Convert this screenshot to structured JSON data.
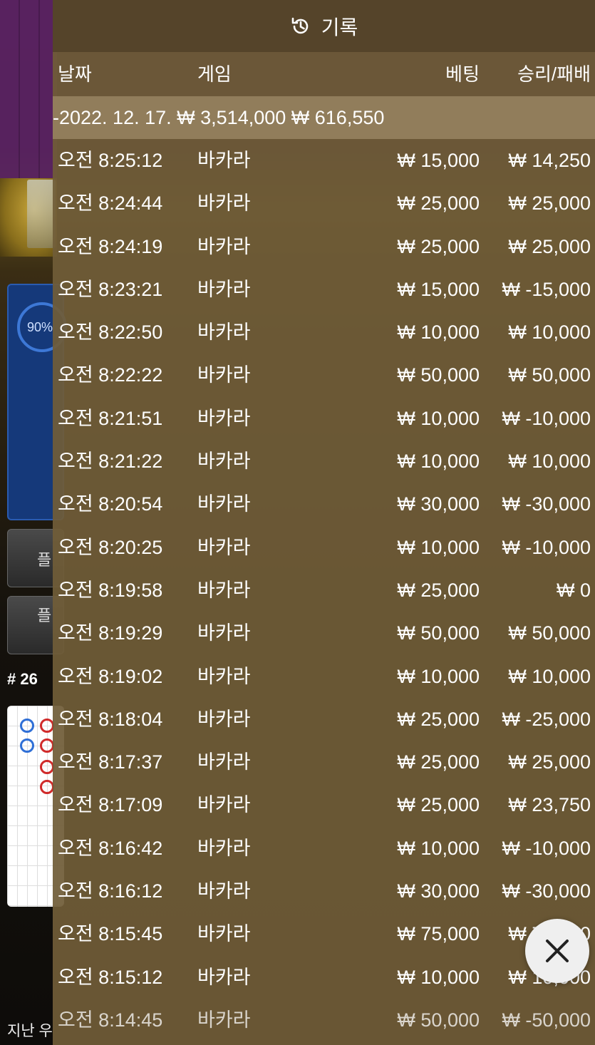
{
  "header": {
    "title": "기록",
    "icon": "history-icon"
  },
  "columns": {
    "date": "날짜",
    "game": "게임",
    "bet": "베팅",
    "result": "승리/패배"
  },
  "date_group": {
    "date": "-2022. 12. 17.",
    "bet_total": "₩ 3,514,000",
    "result_total": "₩ 616,550"
  },
  "rows": [
    {
      "time": "오전 8:25:12",
      "game": "바카라",
      "bet": "₩ 15,000",
      "result": "₩ 14,250"
    },
    {
      "time": "오전 8:24:44",
      "game": "바카라",
      "bet": "₩ 25,000",
      "result": "₩ 25,000"
    },
    {
      "time": "오전 8:24:19",
      "game": "바카라",
      "bet": "₩ 25,000",
      "result": "₩ 25,000"
    },
    {
      "time": "오전 8:23:21",
      "game": "바카라",
      "bet": "₩ 15,000",
      "result": "₩ -15,000"
    },
    {
      "time": "오전 8:22:50",
      "game": "바카라",
      "bet": "₩ 10,000",
      "result": "₩ 10,000"
    },
    {
      "time": "오전 8:22:22",
      "game": "바카라",
      "bet": "₩ 50,000",
      "result": "₩ 50,000"
    },
    {
      "time": "오전 8:21:51",
      "game": "바카라",
      "bet": "₩ 10,000",
      "result": "₩ -10,000"
    },
    {
      "time": "오전 8:21:22",
      "game": "바카라",
      "bet": "₩ 10,000",
      "result": "₩ 10,000"
    },
    {
      "time": "오전 8:20:54",
      "game": "바카라",
      "bet": "₩ 30,000",
      "result": "₩ -30,000"
    },
    {
      "time": "오전 8:20:25",
      "game": "바카라",
      "bet": "₩ 10,000",
      "result": "₩ -10,000"
    },
    {
      "time": "오전 8:19:58",
      "game": "바카라",
      "bet": "₩ 25,000",
      "result": "₩ 0"
    },
    {
      "time": "오전 8:19:29",
      "game": "바카라",
      "bet": "₩ 50,000",
      "result": "₩ 50,000"
    },
    {
      "time": "오전 8:19:02",
      "game": "바카라",
      "bet": "₩ 10,000",
      "result": "₩ 10,000"
    },
    {
      "time": "오전 8:18:04",
      "game": "바카라",
      "bet": "₩ 25,000",
      "result": "₩ -25,000"
    },
    {
      "time": "오전 8:17:37",
      "game": "바카라",
      "bet": "₩ 25,000",
      "result": "₩ 25,000"
    },
    {
      "time": "오전 8:17:09",
      "game": "바카라",
      "bet": "₩ 25,000",
      "result": "₩ 23,750"
    },
    {
      "time": "오전 8:16:42",
      "game": "바카라",
      "bet": "₩ 10,000",
      "result": "₩ -10,000"
    },
    {
      "time": "오전 8:16:12",
      "game": "바카라",
      "bet": "₩ 30,000",
      "result": "₩ -30,000"
    },
    {
      "time": "오전 8:15:45",
      "game": "바카라",
      "bet": "₩ 75,000",
      "result": "₩ 75,000"
    },
    {
      "time": "오전 8:15:12",
      "game": "바카라",
      "bet": "₩ 10,000",
      "result": "₩ 10,000"
    },
    {
      "time": "오전 8:14:45",
      "game": "바카라",
      "bet": "₩ 50,000",
      "result": "₩ -50,000"
    }
  ],
  "background": {
    "ring_label": "90%",
    "button1_label": "플",
    "button2_label": "플",
    "round_label": "# 26",
    "bottom_text": "지난 우"
  },
  "close_button": {
    "icon": "close-icon"
  }
}
